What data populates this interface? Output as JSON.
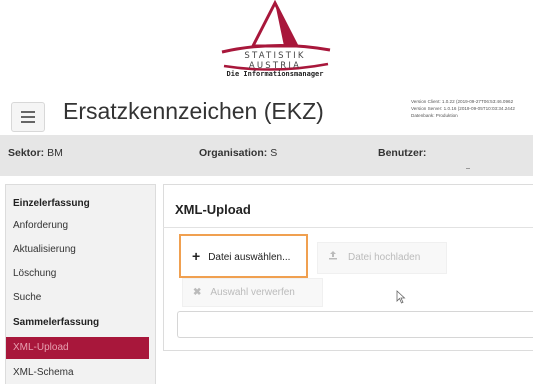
{
  "logo": {
    "name": "STATISTIK AUSTRIA",
    "tagline": "Die Informationsmanager",
    "accent_color": "#a8173b"
  },
  "header": {
    "menu_icon": "hamburger-menu-icon",
    "title": "Ersatzkennzeichen (EKZ)",
    "version_client": "Version Client: 1.0.22 (2019-09-27T06:53:46.0962",
    "version_server": "Version Server: 1.0.16 (2019-09-05T10:03:34.2442",
    "database": "Datenbank:   Produktion"
  },
  "infobar": {
    "sektor_label": "Sektor:",
    "sektor_value": "BM",
    "organisation_label": "Organisation:",
    "organisation_value": "S",
    "benutzer_label": "Benutzer:",
    "benutzer_value": ""
  },
  "sidebar": {
    "sections": [
      {
        "label": "Einzelerfassung"
      },
      {
        "label": "Sammelerfassung"
      }
    ],
    "items": [
      {
        "label": "Anforderung"
      },
      {
        "label": "Aktualisierung"
      },
      {
        "label": "Löschung"
      },
      {
        "label": "Suche"
      },
      {
        "label": "XML-Upload",
        "active": true
      },
      {
        "label": "XML-Schema"
      }
    ]
  },
  "main": {
    "title": "XML-Upload",
    "choose_button": {
      "icon": "plus-icon",
      "label": "Datei auswählen..."
    },
    "upload_button": {
      "icon": "upload-icon",
      "label": "Datei hochladen"
    },
    "discard_button": {
      "icon": "x-icon",
      "label": "Auswahl verwerfen"
    },
    "file_field": {
      "value": ""
    }
  }
}
